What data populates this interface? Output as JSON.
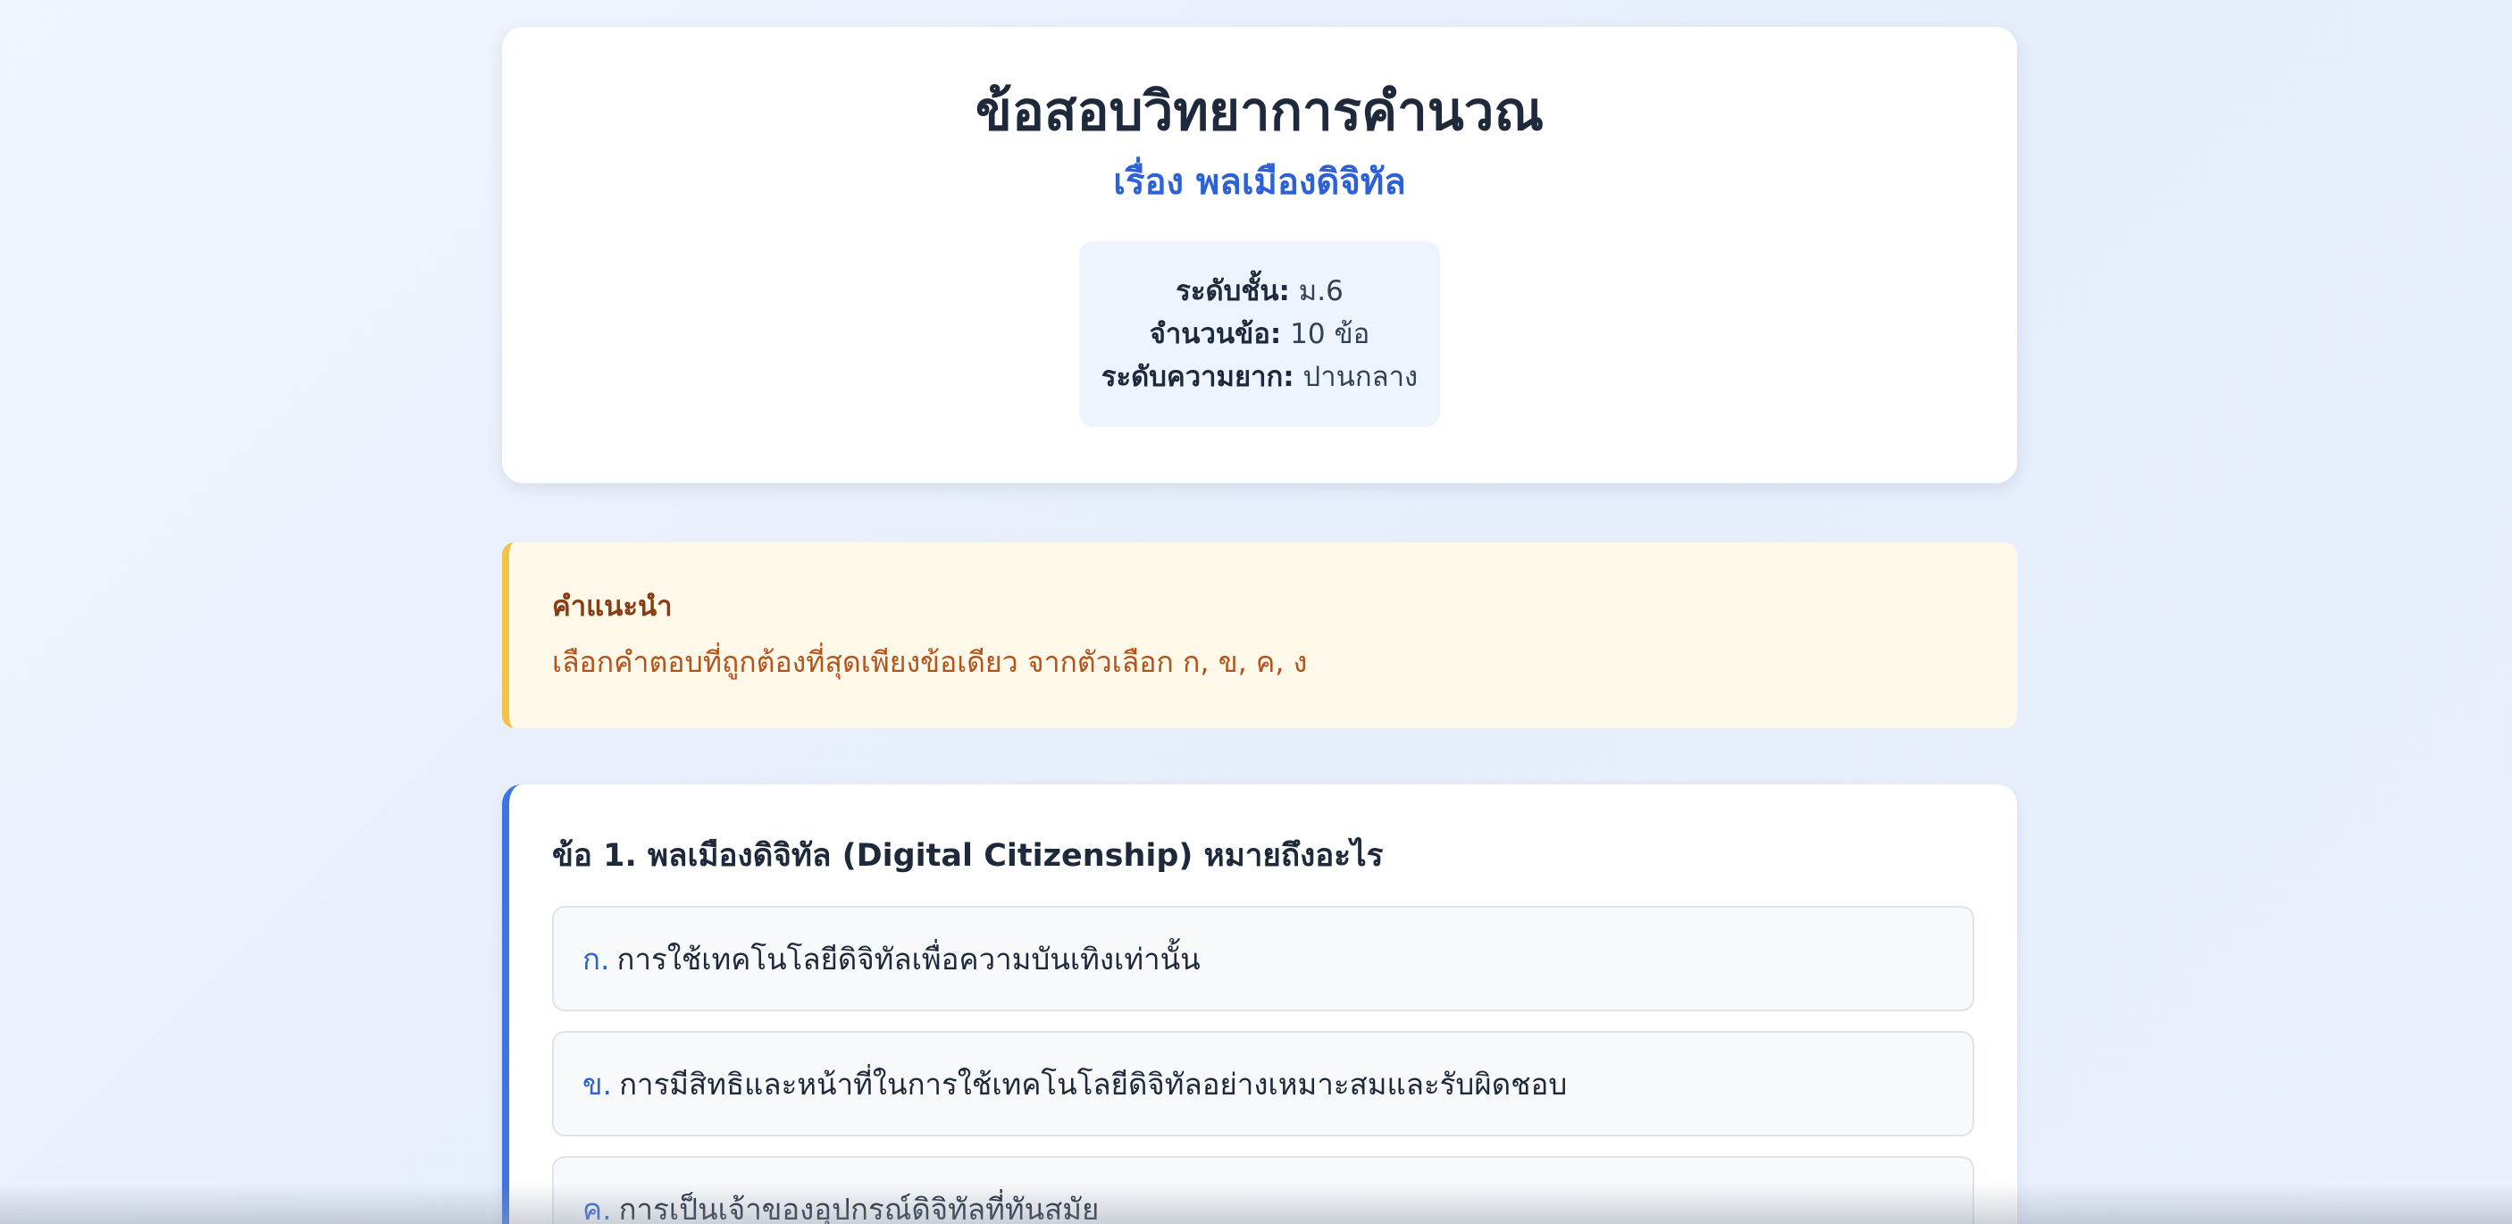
{
  "header": {
    "title": "ข้อสอบวิทยาการคำนวณ",
    "subtitle": "เรื่อง พลเมืองดิจิทัล",
    "info": [
      {
        "label": "ระดับชั้น:",
        "value": "ม.6"
      },
      {
        "label": "จำนวนข้อ:",
        "value": "10 ข้อ"
      },
      {
        "label": "ระดับความยาก:",
        "value": "ปานกลาง"
      }
    ]
  },
  "instructions": {
    "title": "คำแนะนำ",
    "text": "เลือกคำตอบที่ถูกต้องที่สุดเพียงข้อเดียว จากตัวเลือก ก, ข, ค, ง"
  },
  "questions": [
    {
      "text": "ข้อ 1. พลเมืองดิจิทัล (Digital Citizenship) หมายถึงอะไร",
      "options": [
        {
          "letter": "ก.",
          "text": "การใช้เทคโนโลยีดิจิทัลเพื่อความบันเทิงเท่านั้น"
        },
        {
          "letter": "ข.",
          "text": "การมีสิทธิและหน้าที่ในการใช้เทคโนโลยีดิจิทัลอย่างเหมาะสมและรับผิดชอบ"
        },
        {
          "letter": "ค.",
          "text": "การเป็นเจ้าของอุปกรณ์ดิจิทัลที่ทันสมัย"
        }
      ]
    }
  ],
  "colors": {
    "accent": "#2d62d6",
    "question_border": "#3f73e0",
    "instruction_border": "#f2c34a",
    "instruction_bg": "#fef9e9"
  }
}
